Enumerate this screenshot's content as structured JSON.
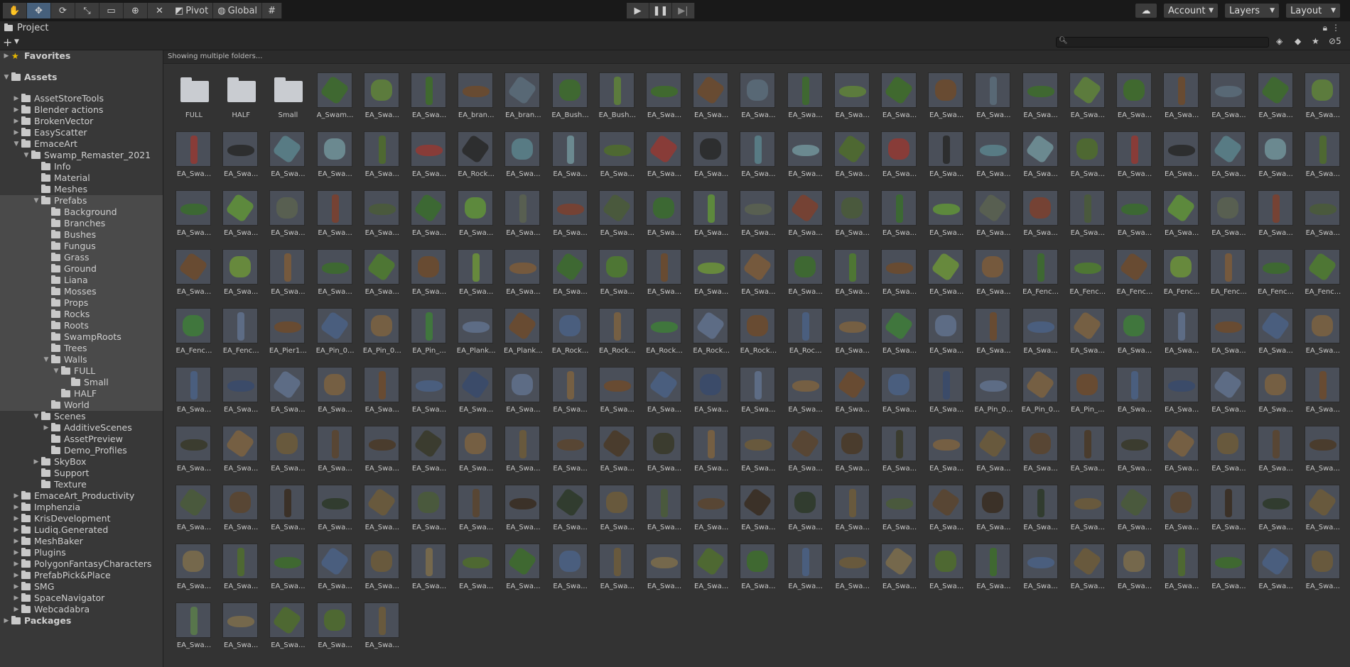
{
  "toolbar": {
    "tools": [
      "hand-tool-icon",
      "move-tool-icon",
      "rotate-tool-icon",
      "scale-tool-icon",
      "rect-tool-icon",
      "transform-tool-icon",
      "custom-tools-icon"
    ],
    "pivot_label": "Pivot",
    "global_label": "Global",
    "grid_snap_icon": "grid-snap-icon",
    "play_icon": "play-icon",
    "pause_icon": "pause-icon",
    "step_icon": "step-icon",
    "cloud_icon": "cloud-icon",
    "account_label": "Account",
    "layers_label": "Layers",
    "layout_label": "Layout"
  },
  "panel": {
    "tab_label": "Project",
    "hidden_count": "5",
    "search_placeholder": ""
  },
  "breadcrumb": "Showing multiple folders...",
  "tree": [
    {
      "label": "Favorites",
      "depth": 0,
      "arrow": "right",
      "type": "star",
      "bold": true,
      "gap": true
    },
    {
      "label": "Assets",
      "depth": 0,
      "arrow": "down",
      "type": "folder",
      "bold": true,
      "gap": true
    },
    {
      "label": "AssetStoreTools",
      "depth": 1,
      "arrow": "right"
    },
    {
      "label": "Blender actions",
      "depth": 1,
      "arrow": "right"
    },
    {
      "label": "BrokenVector",
      "depth": 1,
      "arrow": "right"
    },
    {
      "label": "EasyScatter",
      "depth": 1,
      "arrow": "right"
    },
    {
      "label": "EmaceArt",
      "depth": 1,
      "arrow": "down"
    },
    {
      "label": "Swamp_Remaster_2021",
      "depth": 2,
      "arrow": "down"
    },
    {
      "label": "Info",
      "depth": 3
    },
    {
      "label": "Material",
      "depth": 3
    },
    {
      "label": "Meshes",
      "depth": 3
    },
    {
      "label": "Prefabs",
      "depth": 3,
      "arrow": "down",
      "hl": true
    },
    {
      "label": "Background",
      "depth": 4,
      "hl": true
    },
    {
      "label": "Branches",
      "depth": 4,
      "hl": true
    },
    {
      "label": "Bushes",
      "depth": 4,
      "hl": true
    },
    {
      "label": "Fungus",
      "depth": 4,
      "hl": true
    },
    {
      "label": "Grass",
      "depth": 4,
      "hl": true
    },
    {
      "label": "Ground",
      "depth": 4,
      "hl": true
    },
    {
      "label": "Liana",
      "depth": 4,
      "hl": true
    },
    {
      "label": "Mosses",
      "depth": 4,
      "hl": true
    },
    {
      "label": "Props",
      "depth": 4,
      "hl": true
    },
    {
      "label": "Rocks",
      "depth": 4,
      "hl": true
    },
    {
      "label": "Roots",
      "depth": 4,
      "hl": true
    },
    {
      "label": "SwampRoots",
      "depth": 4,
      "hl": true
    },
    {
      "label": "Trees",
      "depth": 4,
      "hl": true
    },
    {
      "label": "Walls",
      "depth": 4,
      "arrow": "down",
      "hl": true
    },
    {
      "label": "FULL",
      "depth": 5,
      "arrow": "down",
      "hl": true
    },
    {
      "label": "Small",
      "depth": 6,
      "hl": true
    },
    {
      "label": "HALF",
      "depth": 5,
      "hl": true
    },
    {
      "label": "World",
      "depth": 4,
      "hl": true
    },
    {
      "label": "Scenes",
      "depth": 3,
      "arrow": "down"
    },
    {
      "label": "AdditiveScenes",
      "depth": 4,
      "arrow": "right"
    },
    {
      "label": "AssetPreview",
      "depth": 4
    },
    {
      "label": "Demo_Profiles",
      "depth": 4
    },
    {
      "label": "SkyBox",
      "depth": 3,
      "arrow": "right"
    },
    {
      "label": "Support",
      "depth": 3
    },
    {
      "label": "Texture",
      "depth": 3
    },
    {
      "label": "EmaceArt_Productivity",
      "depth": 1,
      "arrow": "right"
    },
    {
      "label": "Imphenzia",
      "depth": 1,
      "arrow": "right"
    },
    {
      "label": "KrisDevelopment",
      "depth": 1,
      "arrow": "right"
    },
    {
      "label": "Ludiq.Generated",
      "depth": 1,
      "arrow": "right"
    },
    {
      "label": "MeshBaker",
      "depth": 1,
      "arrow": "right"
    },
    {
      "label": "Plugins",
      "depth": 1,
      "arrow": "right"
    },
    {
      "label": "PolygonFantasyCharacters",
      "depth": 1,
      "arrow": "right"
    },
    {
      "label": "PrefabPick&Place",
      "depth": 1,
      "arrow": "right"
    },
    {
      "label": "SMG",
      "depth": 1,
      "arrow": "right"
    },
    {
      "label": "SpaceNavigator",
      "depth": 1,
      "arrow": "right"
    },
    {
      "label": "Webcadabra",
      "depth": 1,
      "arrow": "right"
    },
    {
      "label": "Packages",
      "depth": 0,
      "arrow": "right",
      "bold": true
    }
  ],
  "assets": [
    [
      "FULL",
      "HALF",
      "Small",
      "A_Swam...",
      "EA_Swa...",
      "EA_Swa...",
      "EA_bran...",
      "EA_bran...",
      "EA_Bush...",
      "EA_Bush...",
      "EA_Swa...",
      "EA_Swa...",
      "EA_Swa...",
      "EA_Swa...",
      "EA_Swa...",
      "EA_Swa...",
      "EA_Swa...",
      "EA_Swa...",
      "EA_Swa...",
      "EA_Swa...",
      "EA_Swa...",
      "EA_Swa...",
      "EA_Swa...",
      "EA_Swa...",
      "EA_Swa..."
    ],
    [
      "EA_Swa...",
      "EA_Swa...",
      "EA_Swa...",
      "EA_Swa...",
      "EA_Swa...",
      "EA_Swa...",
      "EA_Rock...",
      "EA_Swa...",
      "EA_Swa...",
      "EA_Swa...",
      "EA_Swa...",
      "EA_Swa...",
      "EA_Swa...",
      "EA_Swa...",
      "EA_Swa...",
      "EA_Swa...",
      "EA_Swa...",
      "EA_Swa...",
      "EA_Swa...",
      "EA_Swa...",
      "EA_Swa...",
      "EA_Swa...",
      "EA_Swa...",
      "EA_Swa...",
      "EA_Swa..."
    ],
    [
      "EA_Swa...",
      "EA_Swa...",
      "EA_Swa...",
      "EA_Swa...",
      "EA_Swa...",
      "EA_Swa...",
      "EA_Swa...",
      "EA_Swa...",
      "EA_Swa...",
      "EA_Swa...",
      "EA_Swa...",
      "EA_Swa...",
      "EA_Swa...",
      "EA_Swa...",
      "EA_Swa...",
      "EA_Swa...",
      "EA_Swa...",
      "EA_Swa...",
      "EA_Swa...",
      "EA_Swa...",
      "EA_Swa...",
      "EA_Swa...",
      "EA_Swa...",
      "EA_Swa...",
      "EA_Swa..."
    ],
    [
      "EA_Swa...",
      "EA_Swa...",
      "EA_Swa...",
      "EA_Swa...",
      "EA_Swa...",
      "EA_Swa...",
      "EA_Swa...",
      "EA_Swa...",
      "EA_Swa...",
      "EA_Swa...",
      "EA_Swa...",
      "EA_Swa...",
      "EA_Swa...",
      "EA_Swa...",
      "EA_Swa...",
      "EA_Swa...",
      "EA_Swa...",
      "EA_Swa...",
      "EA_Fenc...",
      "EA_Fenc...",
      "EA_Fenc...",
      "EA_Fenc...",
      "EA_Fenc...",
      "EA_Fenc...",
      "EA_Fenc..."
    ],
    [
      "EA_Fenc...",
      "EA_Fenc...",
      "EA_Pier1...",
      "EA_Pin_0...",
      "EA_Pin_0...",
      "EA_Pin_...",
      "EA_Plank...",
      "EA_Plank...",
      "EA_Rock...",
      "EA_Rock...",
      "EA_Rock...",
      "EA_Rock...",
      "EA_Rock...",
      "EA_Roc...",
      "EA_Swa...",
      "EA_Swa...",
      "EA_Swa...",
      "EA_Swa...",
      "EA_Swa...",
      "EA_Swa...",
      "EA_Swa...",
      "EA_Swa...",
      "EA_Swa...",
      "EA_Swa...",
      "EA_Swa..."
    ],
    [
      "EA_Swa...",
      "EA_Swa...",
      "EA_Swa...",
      "EA_Swa...",
      "EA_Swa...",
      "EA_Swa...",
      "EA_Swa...",
      "EA_Swa...",
      "EA_Swa...",
      "EA_Swa...",
      "EA_Swa...",
      "EA_Swa...",
      "EA_Swa...",
      "EA_Swa...",
      "EA_Swa...",
      "EA_Swa...",
      "EA_Swa...",
      "EA_Pin_0...",
      "EA_Pin_0...",
      "EA_Pin_...",
      "EA_Swa...",
      "EA_Swa...",
      "EA_Swa...",
      "EA_Swa...",
      "EA_Swa..."
    ],
    [
      "EA_Swa...",
      "EA_Swa...",
      "EA_Swa...",
      "EA_Swa...",
      "EA_Swa...",
      "EA_Swa...",
      "EA_Swa...",
      "EA_Swa...",
      "EA_Swa...",
      "EA_Swa...",
      "EA_Swa...",
      "EA_Swa...",
      "EA_Swa...",
      "EA_Swa...",
      "EA_Swa...",
      "EA_Swa...",
      "EA_Swa...",
      "EA_Swa...",
      "EA_Swa...",
      "EA_Swa...",
      "EA_Swa...",
      "EA_Swa...",
      "EA_Swa...",
      "EA_Swa...",
      "EA_Swa..."
    ],
    [
      "EA_Swa...",
      "EA_Swa...",
      "EA_Swa...",
      "EA_Swa...",
      "EA_Swa...",
      "EA_Swa...",
      "EA_Swa...",
      "EA_Swa...",
      "EA_Swa...",
      "EA_Swa...",
      "EA_Swa...",
      "EA_Swa...",
      "EA_Swa...",
      "EA_Swa...",
      "EA_Swa...",
      "EA_Swa...",
      "EA_Swa...",
      "EA_Swa...",
      "EA_Swa...",
      "EA_Swa...",
      "EA_Swa...",
      "EA_Swa...",
      "EA_Swa...",
      "EA_Swa...",
      "EA_Swa..."
    ],
    [
      "EA_Swa...",
      "EA_Swa...",
      "EA_Swa...",
      "EA_Swa...",
      "EA_Swa...",
      "EA_Swa...",
      "EA_Swa...",
      "EA_Swa...",
      "EA_Swa...",
      "EA_Swa...",
      "EA_Swa...",
      "EA_Swa...",
      "EA_Swa...",
      "EA_Swa...",
      "EA_Swa...",
      "EA_Swa...",
      "EA_Swa...",
      "EA_Swa...",
      "EA_Swa...",
      "EA_Swa...",
      "EA_Swa...",
      "EA_Swa...",
      "EA_Swa...",
      "EA_Swa...",
      "EA_Swa..."
    ],
    [
      "EA_Swa...",
      "EA_Swa...",
      "EA_Swa...",
      "EA_Swa...",
      "EA_Swa..."
    ]
  ],
  "row_palettes": [
    [
      "#3f6b2a",
      "#5a6a78",
      "#5e7f3a",
      "#6b4a2e",
      "#3e6a2c"
    ],
    [
      "#6f8f96",
      "#8f3a34",
      "#5a7f88",
      "#4f6a2e",
      "#2a2a2a"
    ],
    [
      "#5f8f3a",
      "#7a4030",
      "#3b6a2f",
      "#5a6050",
      "#4a5a3a"
    ],
    [
      "#4f7a30",
      "#6a8f3a",
      "#3d6a2e",
      "#6b4a2e",
      "#7a5a3a"
    ],
    [
      "#6b4a2e",
      "#7a6040",
      "#5f6f8a",
      "#4a5f82",
      "#3f7a3a"
    ],
    [
      "#4a5f82",
      "#5f6f8a",
      "#6b4a2e",
      "#3a4a6a",
      "#7a6040"
    ],
    [
      "#5a4530",
      "#3a3a2a",
      "#6b5a3a",
      "#4a3a28",
      "#7a6040"
    ],
    [
      "#5a4530",
      "#2f3a2a",
      "#4a5a3a",
      "#3a2e22",
      "#6b5a3a"
    ],
    [
      "#6b5a3a",
      "#4f6a2e",
      "#4a5f82",
      "#7a6a4a",
      "#3e6a2c"
    ],
    [
      "#4f6a2e",
      "#6b5a3a",
      "#7a6a4a",
      "#4f6a2e",
      "#5a7a4a"
    ]
  ]
}
